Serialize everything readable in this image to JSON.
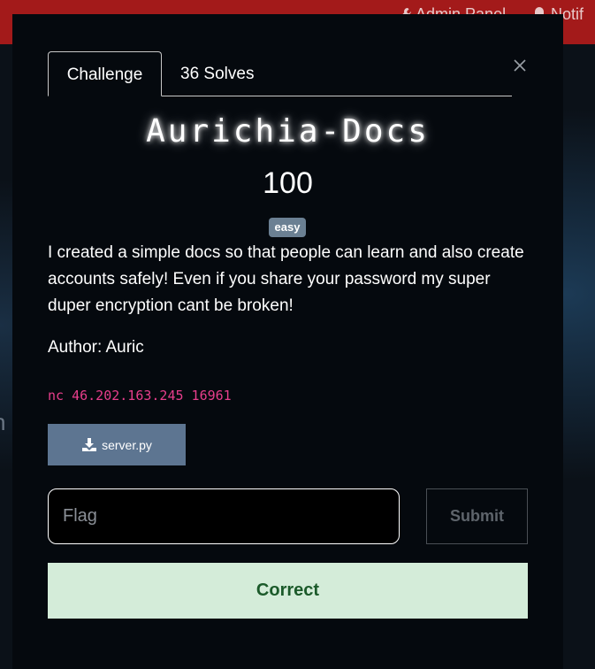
{
  "topbar": {
    "admin_label": "Admin Panel",
    "notif_label": "Notif"
  },
  "background": {
    "partial_text": "n"
  },
  "tabs": [
    {
      "label": "Challenge",
      "active": true
    },
    {
      "label": "36 Solves",
      "active": false
    }
  ],
  "challenge": {
    "name": "Aurichia-Docs",
    "value": "100",
    "difficulty": "easy",
    "description": "I created a simple docs so that people can learn and also create accounts safely! Even if you share your password my super duper encryption cant be broken!",
    "author": "Author: Auric",
    "connection": "nc 46.202.163.245 16961",
    "file_label": "server.py"
  },
  "form": {
    "flag_placeholder": "Flag",
    "flag_value": "",
    "submit_label": "Submit"
  },
  "result": {
    "message": "Correct"
  },
  "colors": {
    "topbar": "#a31a1a",
    "modal_bg": "#05090e",
    "badge": "#6b8093",
    "connection_text": "#e83e8c",
    "download_button": "#5d7591",
    "result_bg": "#d4ecd9",
    "result_text": "#1b5a2a"
  },
  "icons": {
    "admin": "wrench-icon",
    "notif": "bell-icon",
    "close": "close-icon",
    "download": "download-icon"
  }
}
